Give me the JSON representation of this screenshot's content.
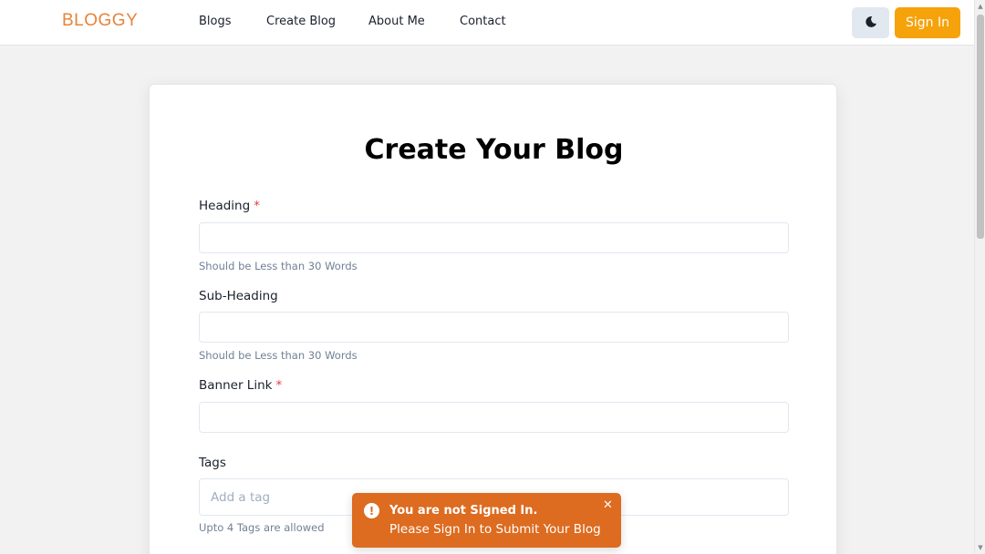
{
  "navbar": {
    "logo": "BLOGGY",
    "links": [
      "Blogs",
      "Create Blog",
      "About Me",
      "Contact"
    ],
    "theme_toggle_icon": "moon-icon",
    "signin_label": "Sign In"
  },
  "form": {
    "title": "Create Your Blog",
    "heading": {
      "label": "Heading",
      "required_mark": "*",
      "value": "",
      "helper": "Should be Less than 30 Words"
    },
    "subheading": {
      "label": "Sub-Heading",
      "value": "",
      "helper": "Should be Less than 30 Words"
    },
    "banner": {
      "label": "Banner Link",
      "required_mark": "*",
      "value": ""
    },
    "tags": {
      "label": "Tags",
      "placeholder": "Add a tag",
      "helper": "Upto 4 Tags are allowed"
    }
  },
  "toast": {
    "icon": "warning-icon",
    "title": "You are not Signed In.",
    "description": "Please Sign In to Submit Your Blog",
    "close_icon": "close-icon"
  },
  "colors": {
    "accent": "#f6a20b",
    "logo": "#e8833a",
    "toast_bg": "#dd6b20",
    "required": "#e53e3e"
  }
}
